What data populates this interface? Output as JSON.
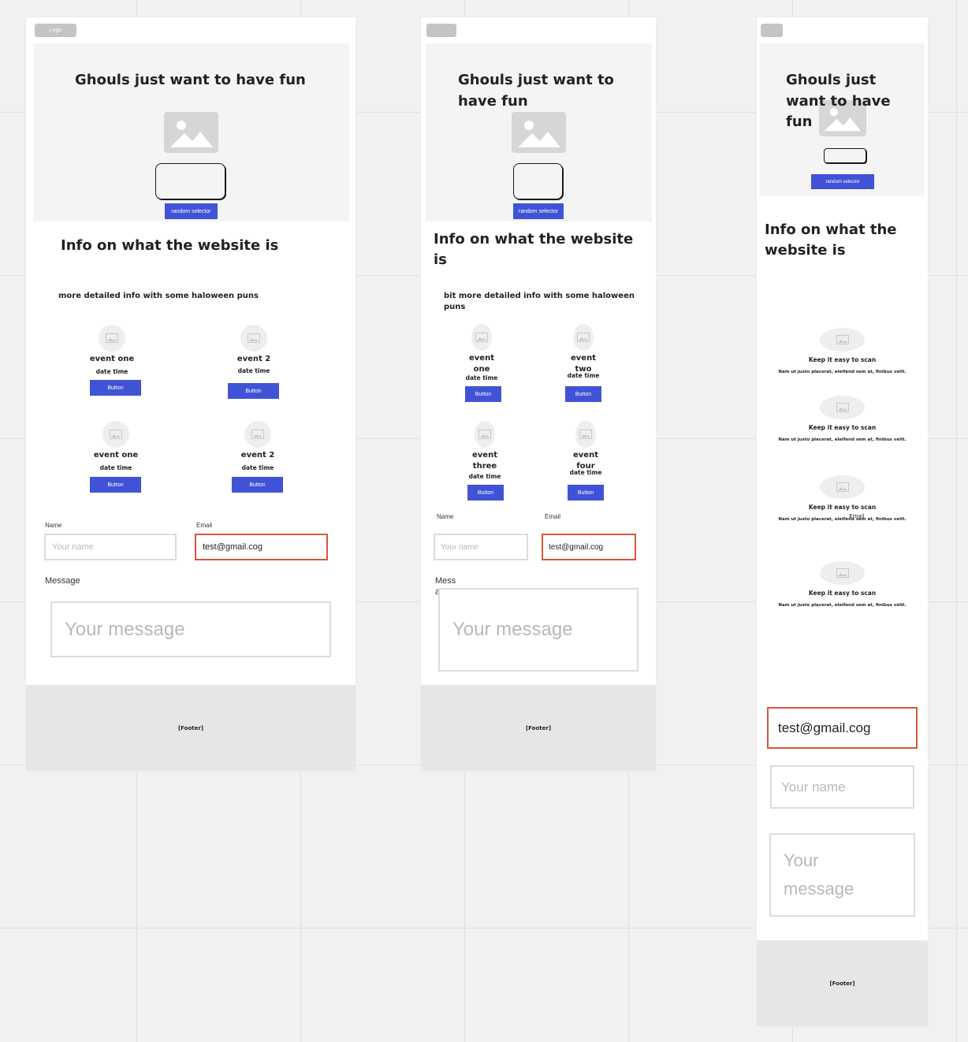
{
  "frame1": {
    "logo": "Logo",
    "hero_title": "Ghouls just want to have fun",
    "random_button": "random selector",
    "info_title": "Info on what the website is",
    "info_text": "more detailed info with some haloween puns",
    "events": [
      {
        "name": "event one",
        "date": "date time",
        "button": "Button"
      },
      {
        "name": "event 2",
        "date": "date time",
        "button": "Button"
      },
      {
        "name": "event one",
        "date": "date time",
        "button": "Button"
      },
      {
        "name": "event 2",
        "date": "date time",
        "button": "Button"
      }
    ],
    "form": {
      "name_label": "Name",
      "name_placeholder": "Your name",
      "email_label": "Email",
      "email_value": "test@gmail.cog",
      "message_label": "Message",
      "message_placeholder": "Your message"
    },
    "footer": "[Footer]"
  },
  "frame2": {
    "hero_title_1": "Ghouls just want to",
    "hero_title_2": "have fun",
    "random_button": "random selector",
    "info_title_1": "Info on what the website",
    "info_title_2": "is",
    "info_text_1": "bit more detailed info with some haloween",
    "info_text_2": "puns",
    "events": [
      {
        "name_1": "event",
        "name_2": "one",
        "date": "date time",
        "button": "Button"
      },
      {
        "name_1": "event",
        "name_2": "two",
        "date": "date time",
        "button": "Button"
      },
      {
        "name_1": "event",
        "name_2": "three",
        "date": "date time",
        "button": "Button"
      },
      {
        "name_1": "event",
        "name_2": "four",
        "date": "date time",
        "button": "Button"
      }
    ],
    "form": {
      "name_label": "Name",
      "name_placeholder": "Your name",
      "email_label": "Email",
      "email_value": "test@gmail.cog",
      "message_label_1": "Mess",
      "message_label_2": "age",
      "message_placeholder": "Your message"
    },
    "footer": "[Footer]"
  },
  "frame3": {
    "hero_title_1": "Ghouls just",
    "hero_title_2": "want to have",
    "hero_title_3": "fun",
    "random_button": "random selector",
    "info_title_1": "Info on what the",
    "info_title_2": "website is",
    "features": [
      {
        "title": "Keep it easy to scan",
        "text": "Nam ut justo placerat, eleifend sem at, finibus velit."
      },
      {
        "title": "Keep it easy to scan",
        "text": "Nam ut justo placerat, eleifend sem at, finibus velit."
      },
      {
        "title": "Keep it easy to scan",
        "text": "Nam ut justo placerat, eleifend sem at, finibus velit."
      },
      {
        "title": "Keep it easy to scan",
        "text": "Nam ut justo placerat, eleifend sem at, finibus velit."
      }
    ],
    "stray_email_label": "Email",
    "form": {
      "email_value": "test@gmail.cog",
      "name_placeholder": "Your name",
      "message_placeholder_1": "Your",
      "message_placeholder_2": "message"
    },
    "footer": "[Footer]"
  }
}
